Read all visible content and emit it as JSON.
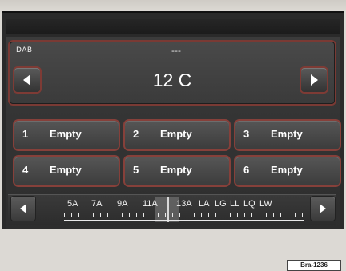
{
  "radio": {
    "source_label": "DAB",
    "ensemble_label": "---",
    "station": "12 C"
  },
  "presets": [
    {
      "num": "1",
      "label": "Empty"
    },
    {
      "num": "2",
      "label": "Empty"
    },
    {
      "num": "3",
      "label": "Empty"
    },
    {
      "num": "4",
      "label": "Empty"
    },
    {
      "num": "5",
      "label": "Empty"
    },
    {
      "num": "6",
      "label": "Empty"
    }
  ],
  "band_scale": {
    "labels": [
      "5A",
      "7A",
      "9A",
      "11A",
      "13A",
      "LA",
      "LG",
      "LL",
      "LQ",
      "LW"
    ],
    "selected": "13A"
  },
  "figure": {
    "code": "Bra-1236"
  },
  "colors": {
    "button_border": "#86403a",
    "screen_bg": "#333333"
  },
  "icons": {
    "prev": "triangle-left",
    "next": "triangle-right"
  }
}
